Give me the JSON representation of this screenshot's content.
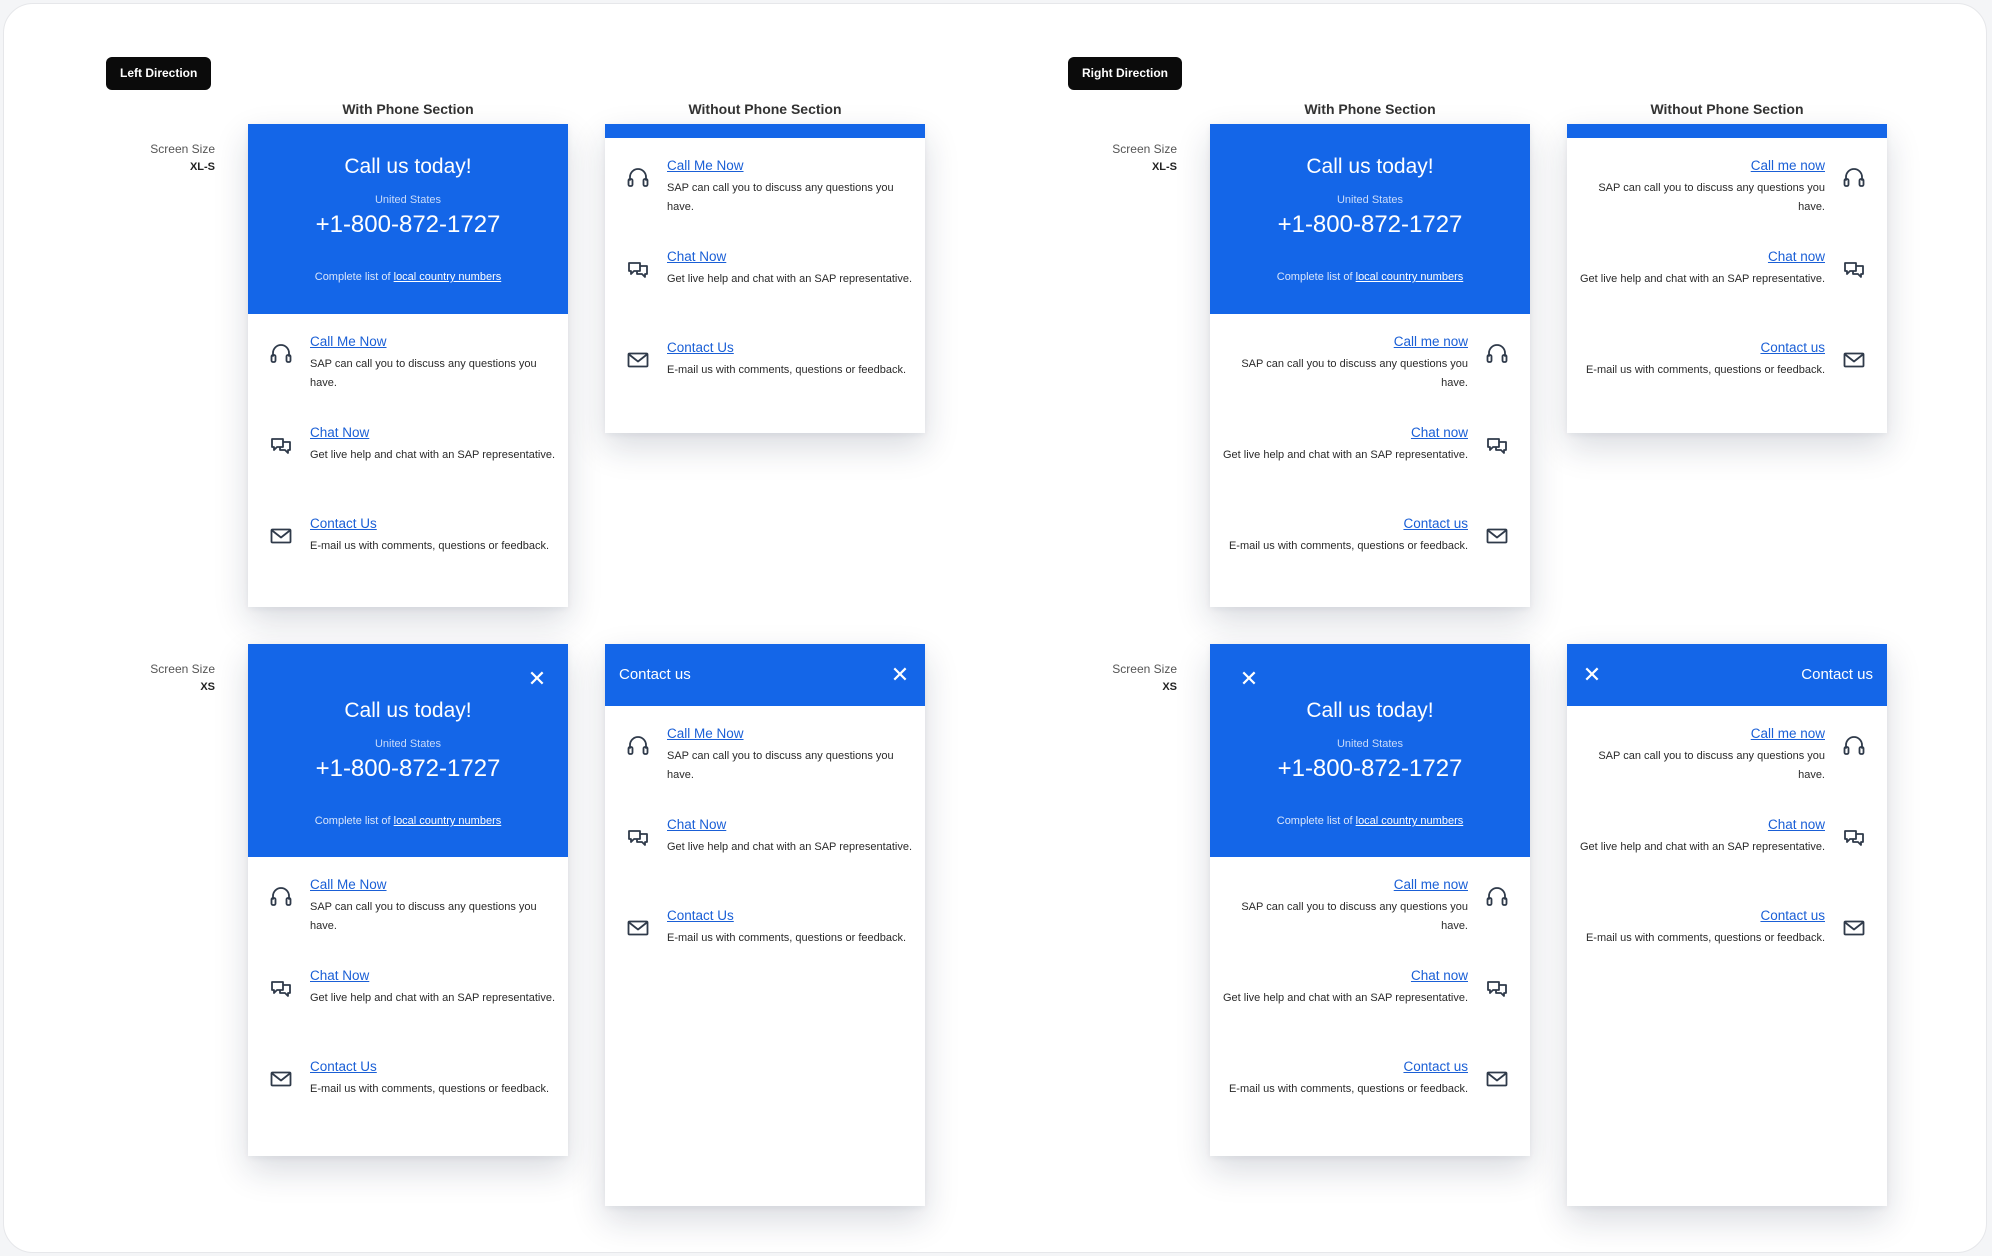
{
  "sections": {
    "left": {
      "tag": "Left Direction",
      "col_with": "With Phone Section",
      "col_without": "Without Phone Section"
    },
    "right": {
      "tag": "Right Direction",
      "col_with": "With Phone Section",
      "col_without": "Without Phone Section"
    }
  },
  "screen_size": {
    "label": "Screen Size",
    "xl": "XL-S",
    "xs": "XS"
  },
  "hero": {
    "title": "Call us today!",
    "country": "United States",
    "phone": "+1-800-872-1727",
    "foot_prefix": "Complete list of ",
    "foot_link": "local country numbers"
  },
  "close_symbol": "✕",
  "bar_title": "Contact us",
  "options_left": [
    {
      "icon": "headset-icon",
      "title": "Call Me Now",
      "desc": "SAP can call you to discuss any questions you have."
    },
    {
      "icon": "chat-icon",
      "title": "Chat Now",
      "desc": "Get live help and chat with an SAP representative."
    },
    {
      "icon": "mail-icon",
      "title": "Contact Us",
      "desc": "E-mail us with comments, questions or feedback."
    }
  ],
  "options_right": [
    {
      "icon": "headset-icon",
      "title": "Call me now",
      "desc": "SAP can call you to discuss any questions you have."
    },
    {
      "icon": "chat-icon",
      "title": "Chat now",
      "desc": "Get live help and chat with an SAP representative."
    },
    {
      "icon": "mail-icon",
      "title": "Contact us",
      "desc": "E-mail us with comments, questions or feedback."
    }
  ],
  "colors": {
    "brand": "#1466e8",
    "link": "#1a5fd6",
    "tag_bg": "#0b0b0b"
  }
}
